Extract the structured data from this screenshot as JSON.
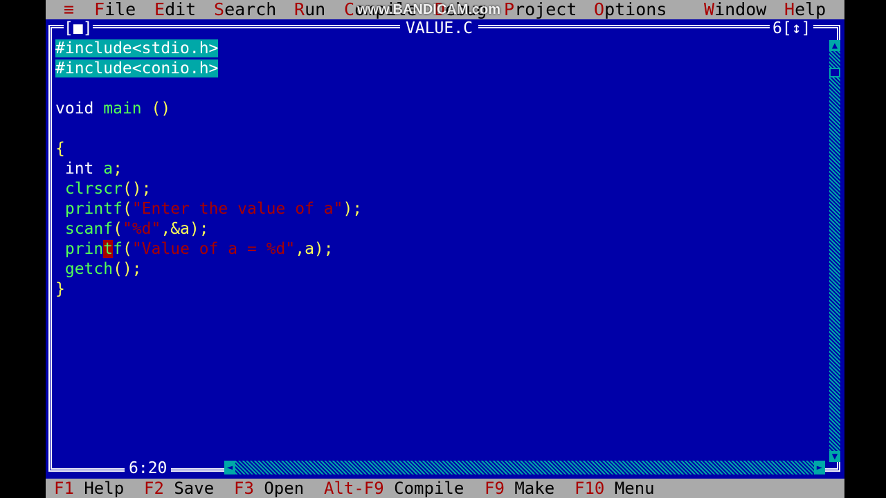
{
  "menu": {
    "system": "≡",
    "items": [
      {
        "hotkey": "F",
        "rest": "ile"
      },
      {
        "hotkey": "E",
        "rest": "dit"
      },
      {
        "hotkey": "S",
        "rest": "earch"
      },
      {
        "hotkey": "R",
        "rest": "un"
      },
      {
        "hotkey": "C",
        "rest": "ompile"
      },
      {
        "hotkey": "D",
        "rest": "ebug"
      },
      {
        "hotkey": "P",
        "rest": "roject"
      },
      {
        "hotkey": "O",
        "rest": "ptions"
      },
      {
        "hotkey": "W",
        "rest": "indow"
      },
      {
        "hotkey": "H",
        "rest": "elp"
      }
    ]
  },
  "watermark": "www.BANDICAM.com",
  "window": {
    "close_box": "[■]",
    "title": "VALUE.C",
    "number": "6",
    "zoom_box": "[↕]"
  },
  "code": {
    "line1": "#include<stdio.h>",
    "line2": "#include<conio.h>",
    "line3_kw": "void",
    "line3_fn": "main",
    "line3_pu": "()",
    "line4": "{",
    "line5_kw": "int",
    "line5_var": "a",
    "line5_pu": ";",
    "line6_fn": "clrscr",
    "line6_pu": "();",
    "line7_fn": "printf",
    "line7_pu1": "(",
    "line7_str": "\"Enter the value of a\"",
    "line7_pu2": ");",
    "line8_fn": "scanf",
    "line8_pu1": "(",
    "line8_str": "\"%d\"",
    "line8_pu2": ",&a);",
    "line9_fn_a": "prin",
    "line9_cursor": "t",
    "line9_fn_b": "f",
    "line9_pu1": "(",
    "line9_str": "\"Value of a = %d\"",
    "line9_pu2": ",a);",
    "line10_fn": "getch",
    "line10_pu": "();",
    "line11": "}"
  },
  "cursor_position": "6:20",
  "status": [
    {
      "key": "F1",
      "label": "Help"
    },
    {
      "key": "F2",
      "label": "Save"
    },
    {
      "key": "F3",
      "label": "Open"
    },
    {
      "key": "Alt-F9",
      "label": "Compile"
    },
    {
      "key": "F9",
      "label": "Make"
    },
    {
      "key": "F10",
      "label": "Menu"
    }
  ],
  "colors": {
    "editor_bg": "#0000A8",
    "menu_bg": "#AAAAAA",
    "hotkey": "#A80000",
    "string": "#A80000",
    "function": "#55FF55",
    "punctuation": "#FFFF55",
    "keyword": "#FFFFFF",
    "selection": "#00A8A8"
  }
}
